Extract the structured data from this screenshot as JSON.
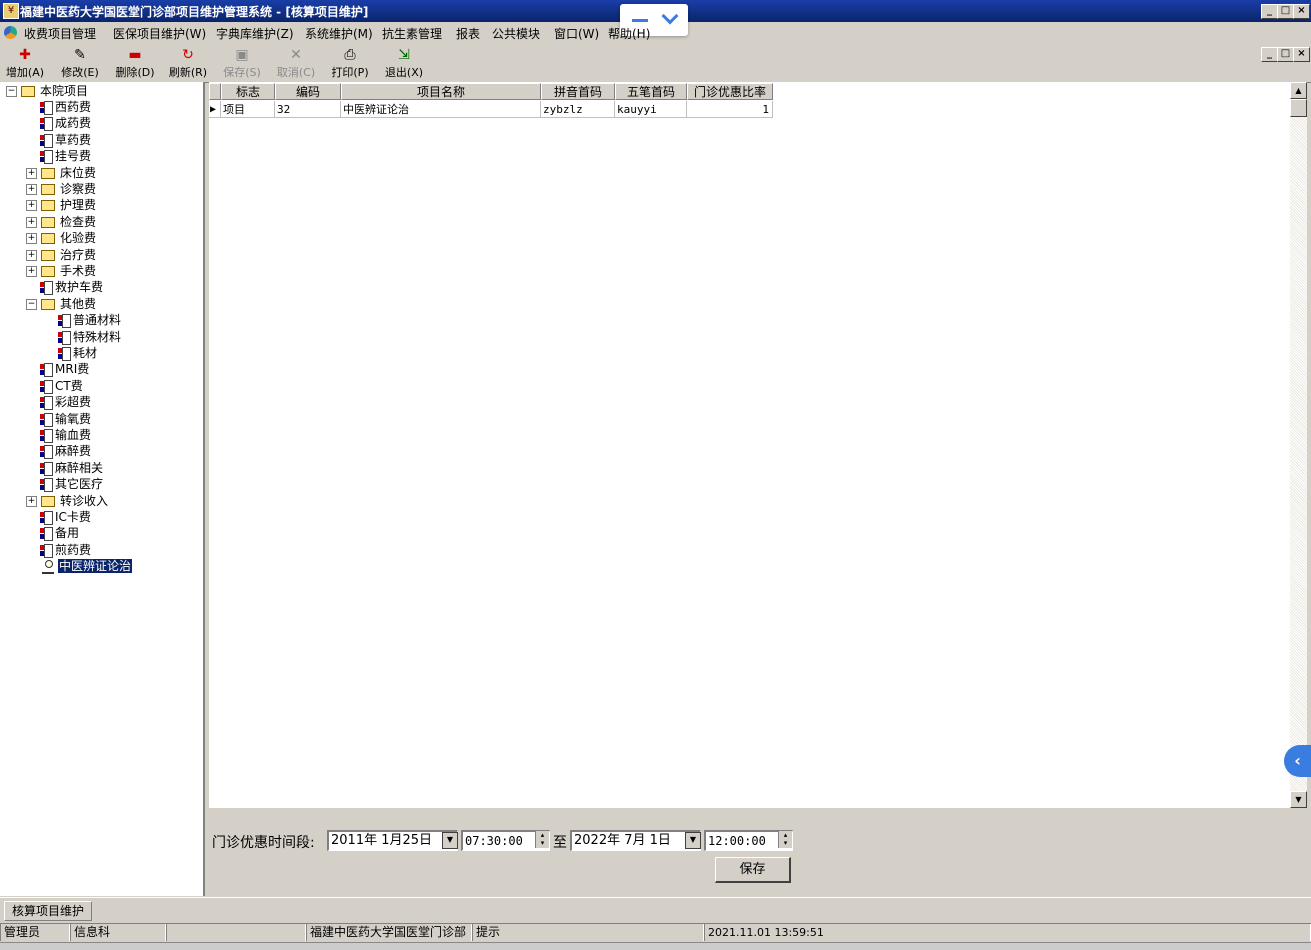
{
  "window": {
    "title": "福建中医药大学国医堂门诊部项目维护管理系统 - [核算项目维护]",
    "controls": [
      "_",
      "□",
      "×"
    ]
  },
  "menubar": {
    "items": [
      "收费项目管理",
      "医保项目维护(W)",
      "字典库维护(Z)",
      "系统维护(M)",
      "抗生素管理",
      "报表",
      "公共模块",
      "窗口(W)",
      "帮助(H)"
    ]
  },
  "toolbar": {
    "add": "增加(A)",
    "edit": "修改(E)",
    "delete": "删除(D)",
    "refresh": "刷新(R)",
    "save": "保存(S)",
    "cancel": "取消(C)",
    "print": "打印(P)",
    "exit": "退出(X)"
  },
  "tree": {
    "root": "本院项目",
    "items": [
      {
        "label": "西药费",
        "kind": "doc"
      },
      {
        "label": "成药费",
        "kind": "doc"
      },
      {
        "label": "草药费",
        "kind": "doc"
      },
      {
        "label": "挂号费",
        "kind": "doc"
      },
      {
        "label": "床位费",
        "kind": "folder"
      },
      {
        "label": "诊察费",
        "kind": "folder"
      },
      {
        "label": "护理费",
        "kind": "folder"
      },
      {
        "label": "检查费",
        "kind": "folder"
      },
      {
        "label": "化验费",
        "kind": "folder"
      },
      {
        "label": "治疗费",
        "kind": "folder"
      },
      {
        "label": "手术费",
        "kind": "folder"
      },
      {
        "label": "救护车费",
        "kind": "doc"
      },
      {
        "label": "其他费",
        "kind": "folder-open"
      },
      {
        "label": "普通材料",
        "kind": "doc-child"
      },
      {
        "label": "特殊材料",
        "kind": "doc-child"
      },
      {
        "label": "耗材",
        "kind": "doc-child"
      },
      {
        "label": "MRI费",
        "kind": "doc"
      },
      {
        "label": "CT费",
        "kind": "doc"
      },
      {
        "label": "彩超费",
        "kind": "doc"
      },
      {
        "label": "输氧费",
        "kind": "doc"
      },
      {
        "label": "输血费",
        "kind": "doc"
      },
      {
        "label": "麻醉费",
        "kind": "doc"
      },
      {
        "label": "麻醉相关",
        "kind": "doc"
      },
      {
        "label": "其它医疗",
        "kind": "doc"
      },
      {
        "label": "转诊收入",
        "kind": "folder"
      },
      {
        "label": "IC卡费",
        "kind": "doc"
      },
      {
        "label": "备用",
        "kind": "doc"
      },
      {
        "label": "煎药费",
        "kind": "doc"
      },
      {
        "label": "中医辨证论治",
        "kind": "selected"
      }
    ]
  },
  "grid": {
    "columns": [
      "标志",
      "编码",
      "项目名称",
      "拼音首码",
      "五笔首码",
      "门诊优惠比率"
    ],
    "rows": [
      {
        "flag": "项目",
        "code": "32",
        "name": "中医辨证论治",
        "pinyin": "zybzlz",
        "wubi": "kauyyi",
        "ratio": "1"
      }
    ]
  },
  "period": {
    "label": "门诊优惠时间段:",
    "start_date": "2011年 1月25日",
    "start_time": "07:30:00",
    "to": "至",
    "end_date": "2022年 7月 1日",
    "end_time": "12:00:00",
    "save": "保存"
  },
  "tabs": {
    "active": "核算项目维护"
  },
  "status": {
    "user": "管理员",
    "dept": "信息科",
    "org": "福建中医药大学国医堂门诊部",
    "hint": "提示",
    "datetime": "2021.11.01  13:59:51"
  },
  "colors": {
    "title": "#0a246a",
    "selected": "#0a246a",
    "face": "#d4d0c8",
    "accent": "#3a7de0"
  }
}
